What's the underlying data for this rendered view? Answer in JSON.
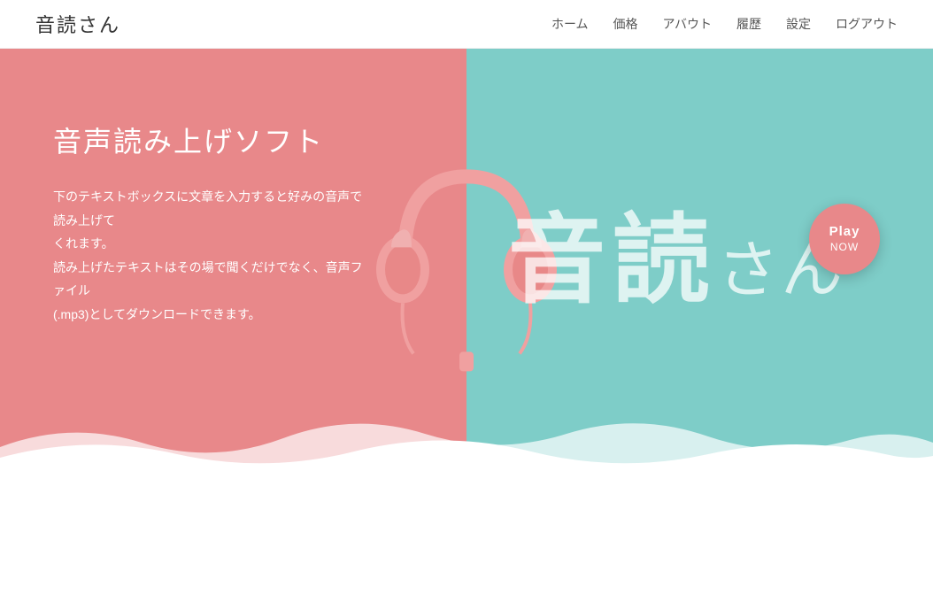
{
  "header": {
    "site_title": "音読さん",
    "nav_items": [
      {
        "label": "ホーム",
        "key": "home"
      },
      {
        "label": "価格",
        "key": "price"
      },
      {
        "label": "アバウト",
        "key": "about"
      },
      {
        "label": "履歴",
        "key": "history"
      },
      {
        "label": "設定",
        "key": "settings"
      },
      {
        "label": "ログアウト",
        "key": "logout"
      }
    ]
  },
  "hero": {
    "title": "音声読み上げソフト",
    "description_line1": "下のテキストボックスに文章を入力すると好みの音声で読み上げて",
    "description_line2": "くれます。",
    "description_line3": "読み上げたテキストはその場で聞くだけでなく、音声ファイル",
    "description_line4": "(.mp3)としてダウンロードできます。",
    "brand_kanji": "音読",
    "brand_san": "さん",
    "play_now_line1": "Play",
    "play_now_line2": "NOW",
    "colors": {
      "left_bg": "#e8888a",
      "right_bg": "#7ecdc8",
      "play_btn": "#e8888a"
    }
  }
}
